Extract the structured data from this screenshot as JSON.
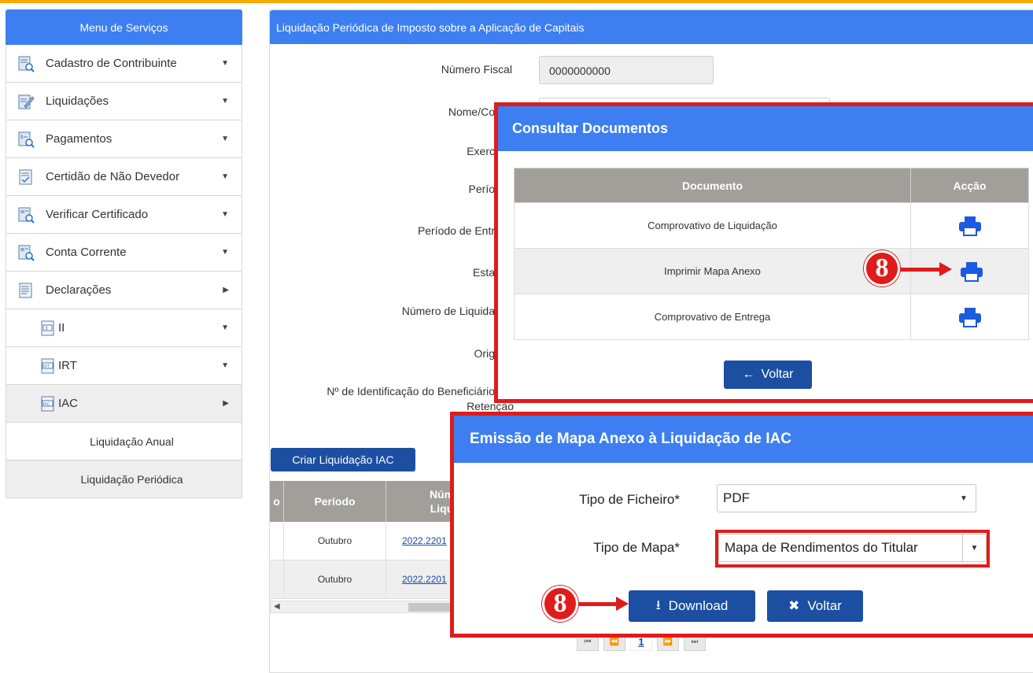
{
  "sidebar": {
    "title": "Menu de Serviços",
    "items": [
      {
        "label": "Cadastro de Contribuinte"
      },
      {
        "label": "Liquidações"
      },
      {
        "label": "Pagamentos"
      },
      {
        "label": "Certidão de Não Devedor"
      },
      {
        "label": "Verificar Certificado"
      },
      {
        "label": "Conta Corrente"
      },
      {
        "label": "Declarações"
      },
      {
        "label": "II"
      },
      {
        "label": "IRT"
      },
      {
        "label": "IAC"
      },
      {
        "label": "Liquidação Anual"
      },
      {
        "label": "Liquidação Periódica"
      }
    ]
  },
  "main": {
    "title": "Liquidação Periódica de Imposto sobre a Aplicação de Capitais",
    "labels": {
      "numero_fiscal": "Número Fiscal",
      "nome": "Nome/Co",
      "exercicio": "Exerc",
      "periodo": "Perío",
      "periodo_entrega": "Período de Entr",
      "estado": "Esta",
      "numero_liquidacao": "Número de Liquida",
      "origem": "Orig",
      "beneficiario_line1": "Nº de Identificação do Beneficiário",
      "beneficiario_line2": "Retenção"
    },
    "numero_fiscal_value": "0000000000",
    "criar_button": "Criar Liquidação IAC",
    "table": {
      "headers": [
        "o",
        "Período",
        "Núm",
        "Liqu"
      ],
      "rows": [
        {
          "periodo": "Outubro",
          "numero": "2022.2201"
        },
        {
          "periodo": "Outubro",
          "numero": "2022.2201"
        }
      ]
    },
    "pager": {
      "current": "1"
    }
  },
  "consultar_modal": {
    "title": "Consultar Documentos",
    "col_documento": "Documento",
    "col_accao": "Acção",
    "rows": [
      {
        "documento": "Comprovativo de Liquidação"
      },
      {
        "documento": "Imprimir Mapa Anexo"
      },
      {
        "documento": "Comprovativo de Entrega"
      }
    ],
    "voltar": "Voltar"
  },
  "emissao_modal": {
    "title": "Emissão de Mapa Anexo à Liquidação de IAC",
    "tipo_ficheiro_label": "Tipo de Ficheiro*",
    "tipo_ficheiro_value": "PDF",
    "tipo_mapa_label": "Tipo de Mapa*",
    "tipo_mapa_value": "Mapa de Rendimentos do Titular",
    "download": "Download",
    "voltar": "Voltar"
  },
  "annotations": {
    "step_print": "8",
    "step_download": "8"
  },
  "colors": {
    "header_blue": "#3d7ff0",
    "button_navy": "#1c4fa1",
    "highlight_red": "#e01b1b",
    "top_bar": "#f7a800"
  }
}
